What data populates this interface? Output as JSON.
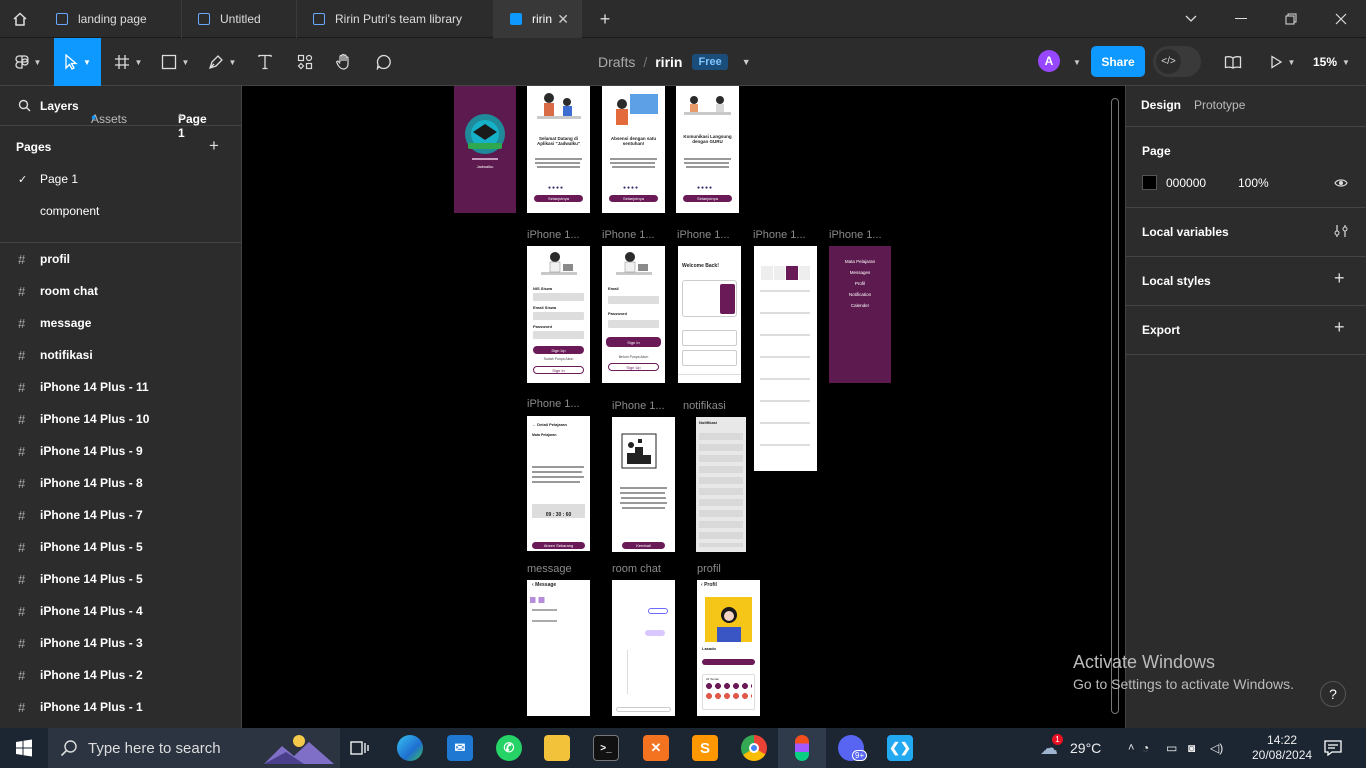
{
  "tabs": [
    {
      "label": "landing page"
    },
    {
      "label": "Untitled"
    },
    {
      "label": "Ririn Putri's team library"
    },
    {
      "label": "ririn"
    }
  ],
  "toolbar": {
    "breadcrumb_root": "Drafts",
    "breadcrumb_sep": "/",
    "file_name": "ririn",
    "plan_badge": "Free",
    "avatar_letter": "A",
    "share_label": "Share",
    "zoom": "15%",
    "accent_color": "#0d99ff"
  },
  "left_panel": {
    "tab_layers": "Layers",
    "tab_assets": "Assets",
    "page_selector": "Page 1",
    "pages_title": "Pages",
    "pages": [
      {
        "label": "Page 1",
        "checked": "✓"
      },
      {
        "label": "component",
        "checked": ""
      }
    ],
    "layers": [
      {
        "hash": "#",
        "label": "profil"
      },
      {
        "hash": "#",
        "label": "room chat"
      },
      {
        "hash": "#",
        "label": "message"
      },
      {
        "hash": "#",
        "label": "notifikasi"
      },
      {
        "hash": "#",
        "label": "iPhone 14 Plus - 11"
      },
      {
        "hash": "#",
        "label": "iPhone 14 Plus - 10"
      },
      {
        "hash": "#",
        "label": "iPhone 14 Plus - 9"
      },
      {
        "hash": "#",
        "label": "iPhone 14 Plus - 8"
      },
      {
        "hash": "#",
        "label": "iPhone 14 Plus - 7"
      },
      {
        "hash": "#",
        "label": "iPhone 14 Plus - 5"
      },
      {
        "hash": "#",
        "label": "iPhone 14 Plus - 5"
      },
      {
        "hash": "#",
        "label": "iPhone 14 Plus - 4"
      },
      {
        "hash": "#",
        "label": "iPhone 14 Plus - 3"
      },
      {
        "hash": "#",
        "label": "iPhone 14 Plus - 2"
      },
      {
        "hash": "#",
        "label": "iPhone 14 Plus - 1"
      }
    ]
  },
  "canvas": {
    "frame_labels": {
      "r2": [
        "iPhone 1...",
        "iPhone 1...",
        "iPhone 1...",
        "iPhone 1...",
        "iPhone 1..."
      ],
      "r3": [
        "iPhone 1...",
        "iPhone 1...",
        "notifikasi"
      ],
      "r4": [
        "message",
        "room chat",
        "profil"
      ]
    },
    "onboarding": [
      {
        "title": "Selamat Datang di Aplikasi \"Jadwalku\"",
        "button": "Selanjutnya"
      },
      {
        "title": "Absensi dengan satu sentuhan!",
        "button": "Selanjutnya"
      },
      {
        "title": "Komunikasi Langsung dengan GURU",
        "button": "Selanjutnya"
      }
    ],
    "splash_name": "Jadwalku",
    "signup": {
      "f1": "NIS Siswa",
      "f2": "Email Siswa",
      "f3": "Password",
      "btn": "Sign Up",
      "or": "Sudah Punya Akun",
      "btn2": "Sign In"
    },
    "signin": {
      "f1": "Email",
      "f2": "Password",
      "btn": "Sign In",
      "or": "Belum Punya Akun",
      "btn2": "Sign Up"
    },
    "home_title": "Welcome Back!",
    "menu_items": [
      "Mata Pelajaran",
      "Messages",
      "Profil",
      "Notification",
      "Calender"
    ],
    "detail": {
      "title": "Detail Pelajaran",
      "label": "Mata Pelajaran",
      "timer": "09 : 30 : 60",
      "button": "Absen Sekarang"
    },
    "trophy_btn": "Kembali",
    "notif_title": "Notifikasi",
    "message_title": "Message",
    "profile": {
      "title": "Profil",
      "name": "Lasado",
      "badges": "24 Teman"
    }
  },
  "right_panel": {
    "tab_design": "Design",
    "tab_prototype": "Prototype",
    "page_title": "Page",
    "page_color_hex": "000000",
    "page_opacity": "100%",
    "local_variables": "Local variables",
    "local_styles": "Local styles",
    "export": "Export"
  },
  "overlay": {
    "activate_title": "Activate Windows",
    "activate_sub": "Go to Settings to activate Windows.",
    "help": "?"
  },
  "taskbar": {
    "search_placeholder": "Type here to search",
    "weather_temp": "29°C",
    "time": "14:22",
    "date": "20/08/2024",
    "notif_badge": "1",
    "discord_badge": "9+"
  }
}
